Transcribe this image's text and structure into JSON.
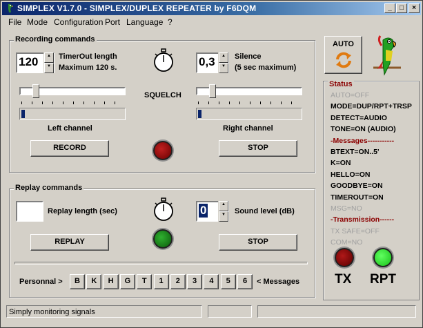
{
  "window": {
    "title": "SIMPLEX V1.7.0 - SIMPLEX/DUPLEX REPEATER by F6DQM"
  },
  "menu": [
    {
      "label": "File"
    },
    {
      "label": "Mode"
    },
    {
      "label": "Configuration"
    },
    {
      "label": "Port"
    },
    {
      "label": "Language"
    },
    {
      "label": "?"
    }
  ],
  "recording": {
    "group_label": "Recording commands",
    "timeout_value": "120",
    "timeout_label": "TimerOut length",
    "timeout_max": "Maximum 120 s.",
    "silence_value": "0,3",
    "silence_label": "Silence",
    "silence_max": "(5 sec maximum)",
    "squelch_label": "SQUELCH",
    "left_channel": "Left channel",
    "right_channel": "Right channel",
    "left_slider": 0.12,
    "right_slider": 0.12,
    "left_level": 0.03,
    "right_level": 0.03,
    "record_button": "RECORD",
    "stop_button": "STOP"
  },
  "replay": {
    "group_label": "Replay commands",
    "length_label": "Replay length (sec)",
    "length_value": "",
    "sound_value": "0",
    "sound_label": "Sound level (dB)",
    "replay_button": "REPLAY",
    "stop_button": "STOP",
    "personnal_label": "Personnal >",
    "messages_label": "< Messages",
    "keys": [
      "B",
      "K",
      "H",
      "G",
      "T",
      "1",
      "2",
      "3",
      "4",
      "5",
      "6"
    ]
  },
  "auto_button": "AUTO",
  "status": {
    "title": "Status",
    "lines": [
      {
        "text": "AUTO=OFF",
        "style": "dis"
      },
      {
        "text": "MODE=DUP/RPT+TRSP",
        "style": "normal"
      },
      {
        "text": "DETECT=AUDIO",
        "style": "normal"
      },
      {
        "text": "TONE=ON (AUDIO)",
        "style": "normal"
      },
      {
        "text": "-Messages-----------",
        "style": "red"
      },
      {
        "text": "BTEXT=ON..5'",
        "style": "normal"
      },
      {
        "text": "K=ON",
        "style": "normal"
      },
      {
        "text": "HELLO=ON",
        "style": "normal"
      },
      {
        "text": "GOODBYE=ON",
        "style": "normal"
      },
      {
        "text": "TIMEROUT=ON",
        "style": "normal"
      },
      {
        "text": "MSG=NO",
        "style": "dis"
      },
      {
        "text": "-Transmission------",
        "style": "red"
      },
      {
        "text": "TX SAFE=OFF",
        "style": "dis"
      },
      {
        "text": "COM=NO",
        "style": "dis"
      }
    ],
    "tx_label": "TX",
    "rpt_label": "RPT"
  },
  "colors": {
    "led_red": "#7a0000",
    "led_green": "#1e8c1e",
    "led_bright_green": "#22e022"
  },
  "statusbar": {
    "message": "Simply monitoring signals"
  }
}
